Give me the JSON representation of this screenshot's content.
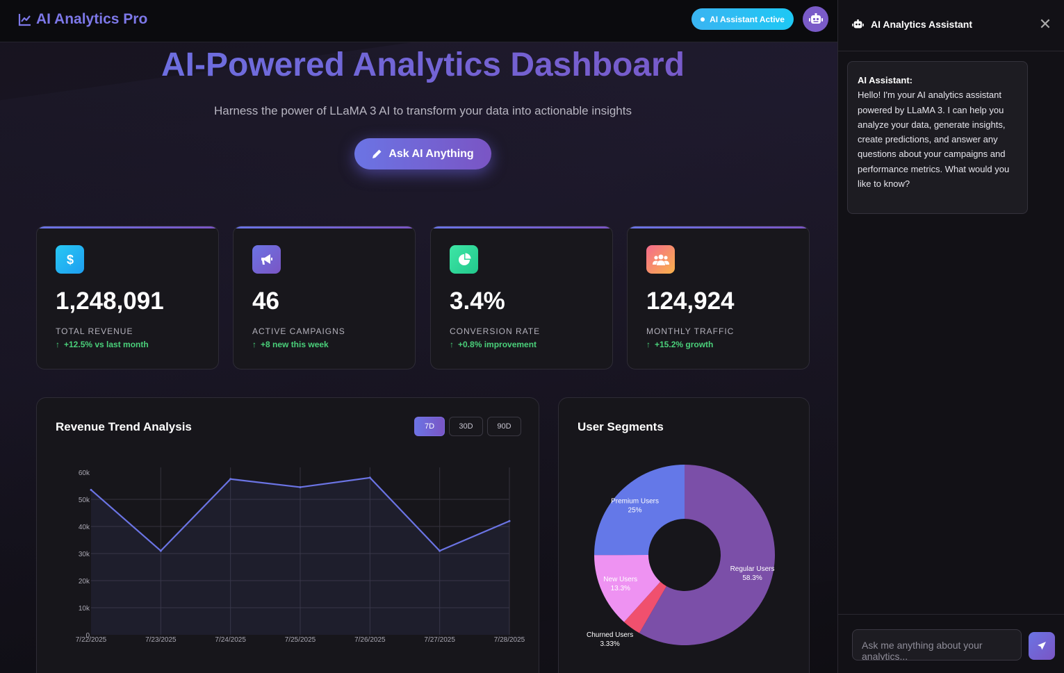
{
  "app": {
    "logo_text": "AI Analytics Pro",
    "status_text": "AI Assistant Active"
  },
  "hero": {
    "title": "AI-Powered Analytics Dashboard",
    "subtitle": "Harness the power of LLaMA 3 AI to transform your data into actionable insights",
    "cta_label": "Ask AI Anything"
  },
  "stats": [
    {
      "icon": "dollar-icon",
      "color": "#22b8f0",
      "value": "1,248,091",
      "label": "TOTAL REVENUE",
      "change": "+12.5% vs last month"
    },
    {
      "icon": "megaphone-icon",
      "color": "#6a5fd8",
      "value": "46",
      "label": "ACTIVE CAMPAIGNS",
      "change": "+8 new this week"
    },
    {
      "icon": "pie-chart-icon",
      "color": "#2ed89a",
      "value": "3.4%",
      "label": "CONVERSION RATE",
      "change": "+0.8% improvement"
    },
    {
      "icon": "users-icon",
      "color": "#f58a5c",
      "value": "124,924",
      "label": "MONTHLY TRAFFIC",
      "change": "+15.2% growth"
    }
  ],
  "revenue_panel": {
    "title": "Revenue Trend Analysis",
    "ranges": [
      "7D",
      "30D",
      "90D"
    ],
    "active_range": "7D"
  },
  "segments_panel": {
    "title": "User Segments"
  },
  "chart_data": [
    {
      "type": "area",
      "title": "Revenue Trend Analysis",
      "x": [
        "7/22/2025",
        "7/23/2025",
        "7/24/2025",
        "7/25/2025",
        "7/26/2025",
        "7/27/2025",
        "7/28/2025"
      ],
      "y_ticks": [
        "0",
        "10k",
        "20k",
        "30k",
        "40k",
        "50k",
        "60k"
      ],
      "series": [
        {
          "values": [
            53500,
            31000,
            57500,
            54500,
            58000,
            31000,
            42000
          ]
        }
      ],
      "ylim": [
        0,
        60000
      ],
      "grid": true,
      "color": "#6b74e4"
    },
    {
      "type": "pie",
      "title": "User Segments",
      "donut": true,
      "slices": [
        {
          "label": "Regular Users",
          "pct_text": "58.3%",
          "value": 58.3,
          "color": "#7b4fa8"
        },
        {
          "label": "Churned Users",
          "pct_text": "3.33%",
          "value": 3.33,
          "color": "#f0506e"
        },
        {
          "label": "New Users",
          "pct_text": "13.3%",
          "value": 13.3,
          "color": "#ee92f2"
        },
        {
          "label": "Premium Users",
          "pct_text": "25%",
          "value": 25,
          "color": "#6478e8"
        }
      ]
    }
  ],
  "assistant": {
    "title": "AI Analytics Assistant",
    "message_sender": "AI Assistant:",
    "message_text": "Hello! I'm your AI analytics assistant powered by LLaMA 3. I can help you analyze your data, generate insights, create predictions, and answer any questions about your campaigns and performance metrics. What would you like to know?",
    "input_placeholder": "Ask me anything about your analytics..."
  }
}
